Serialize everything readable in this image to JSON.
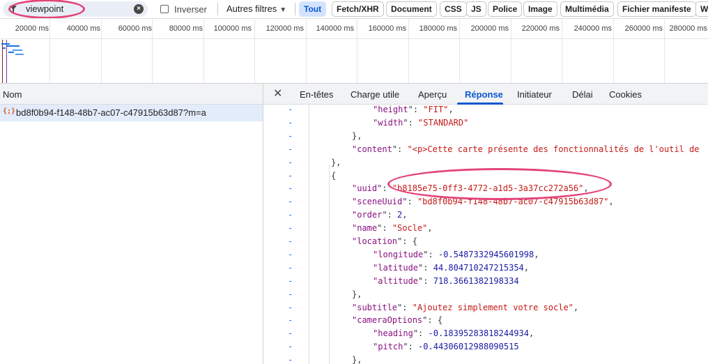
{
  "filter": {
    "search_value": "viewpoint",
    "clear_icon": "close-circle-icon",
    "filter_icon": "funnel-icon",
    "invert_label": "Inverser",
    "more_filters_label": "Autres filtres",
    "types": [
      "Tout",
      "Fetch/XHR",
      "Document",
      "CSS",
      "JS",
      "Police",
      "Image",
      "Multimédia",
      "Fichier manifeste",
      "W"
    ],
    "active_type": "Tout"
  },
  "timeline": {
    "ticks": [
      "20000 ms",
      "40000 ms",
      "60000 ms",
      "80000 ms",
      "100000 ms",
      "120000 ms",
      "140000 ms",
      "160000 ms",
      "180000 ms",
      "200000 ms",
      "220000 ms",
      "240000 ms",
      "260000 ms",
      "280000 ms"
    ]
  },
  "request_list": {
    "column_header": "Nom",
    "rows": [
      {
        "icon": "{;}",
        "name": "bd8f0b94-f148-48b7-ac07-c47915b63d87?m=a"
      }
    ]
  },
  "details": {
    "close_icon": "close-icon",
    "tabs": [
      "En-têtes",
      "Charge utile",
      "Aperçu",
      "Réponse",
      "Initiateur",
      "Délai",
      "Cookies"
    ],
    "active_tab": "Réponse",
    "lines": [
      {
        "indent": 3,
        "key": "height",
        "value": "\"FIT\"",
        "vtype": "s",
        "trail": ","
      },
      {
        "indent": 3,
        "key": "width",
        "value": "\"STANDARD\"",
        "vtype": "s",
        "trail": ""
      },
      {
        "indent": 2,
        "raw": "},"
      },
      {
        "indent": 2,
        "key": "content",
        "value": "\"<p>Cette carte présente des fonctionnalités de l'outil de",
        "vtype": "s",
        "trail": ""
      },
      {
        "indent": 1,
        "raw": "},"
      },
      {
        "indent": 1,
        "raw": "{"
      },
      {
        "indent": 2,
        "key": "uuid",
        "value": "\"b8185e75-0ff3-4772-a1d5-3a37cc272a56\"",
        "vtype": "s",
        "trail": ","
      },
      {
        "indent": 2,
        "key": "sceneUuid",
        "value": "\"bd8f0b94-f148-48b7-ac07-c47915b63d87\"",
        "vtype": "s",
        "trail": ","
      },
      {
        "indent": 2,
        "key": "order",
        "value": "2",
        "vtype": "n",
        "trail": ","
      },
      {
        "indent": 2,
        "key": "name",
        "value": "\"Socle\"",
        "vtype": "s",
        "trail": ","
      },
      {
        "indent": 2,
        "key": "location",
        "value": "{",
        "vtype": "p",
        "trail": ""
      },
      {
        "indent": 3,
        "key": "longitude",
        "value": "-0.5487332945601998",
        "vtype": "n",
        "trail": ","
      },
      {
        "indent": 3,
        "key": "latitude",
        "value": "44.804710247215354",
        "vtype": "n",
        "trail": ","
      },
      {
        "indent": 3,
        "key": "altitude",
        "value": "718.3661382198334",
        "vtype": "n",
        "trail": ""
      },
      {
        "indent": 2,
        "raw": "},"
      },
      {
        "indent": 2,
        "key": "subtitle",
        "value": "\"Ajoutez simplement votre socle\"",
        "vtype": "s",
        "trail": ","
      },
      {
        "indent": 2,
        "key": "cameraOptions",
        "value": "{",
        "vtype": "p",
        "trail": ""
      },
      {
        "indent": 3,
        "key": "heading",
        "value": "-0.18395283818244934",
        "vtype": "n",
        "trail": ","
      },
      {
        "indent": 3,
        "key": "pitch",
        "value": "-0.44306012988090515",
        "vtype": "n",
        "trail": ""
      },
      {
        "indent": 2,
        "raw": "},"
      }
    ]
  },
  "colors": {
    "accent": "#0b57d0",
    "highlight_annotation": "#e3447a",
    "json_key": "#881280",
    "json_string": "#c41a16",
    "json_number": "#1a1aa6"
  }
}
